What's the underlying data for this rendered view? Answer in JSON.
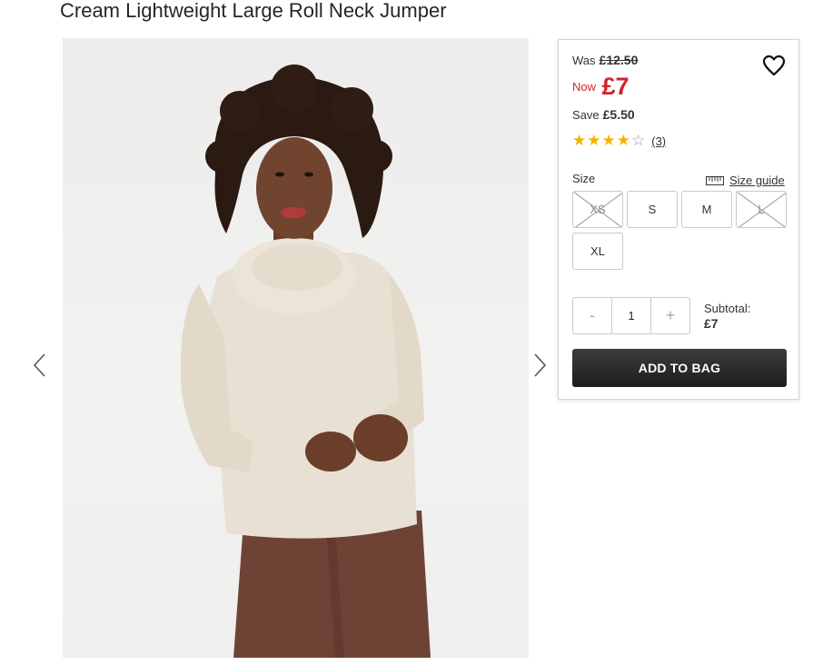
{
  "product": {
    "title": "Cream Lightweight Large Roll Neck Jumper",
    "image_alt": "Model wearing cream roll neck jumper with brown satin skirt"
  },
  "price": {
    "was_label": "Was",
    "was_value": "£12.50",
    "now_label": "Now",
    "now_value": "£7",
    "save_label": "Save",
    "save_value": "£5.50",
    "now_color": "#d2232a"
  },
  "rating": {
    "stars": 4,
    "max": 5,
    "count": "(3)",
    "star_color": "#f5b301"
  },
  "size": {
    "label": "Size",
    "guide_label": "Size guide",
    "options": [
      {
        "label": "XS",
        "available": false
      },
      {
        "label": "S",
        "available": true
      },
      {
        "label": "M",
        "available": true
      },
      {
        "label": "L",
        "available": false
      },
      {
        "label": "XL",
        "available": true
      }
    ]
  },
  "quantity": {
    "minus": "-",
    "value": "1",
    "plus": "+"
  },
  "subtotal": {
    "label": "Subtotal:",
    "value": "£7"
  },
  "add_to_bag": "ADD TO BAG",
  "icons": {
    "prev": "chevron-left-icon",
    "next": "chevron-right-icon",
    "wishlist": "heart-icon",
    "size_guide": "ruler-icon"
  }
}
